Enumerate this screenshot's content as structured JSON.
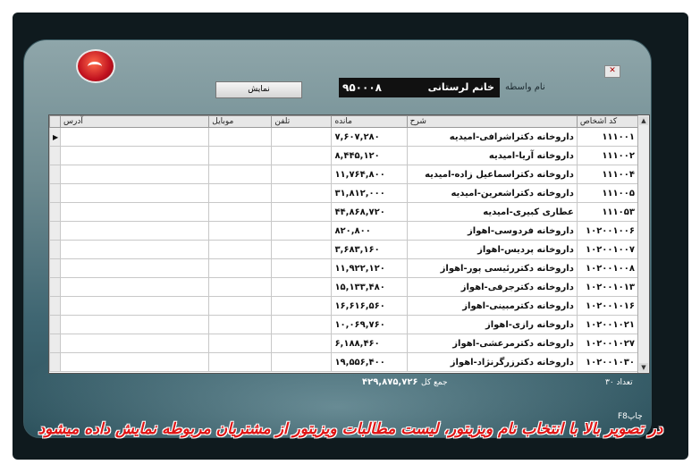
{
  "header": {
    "name_label": "نام واسطه",
    "name_value": "خانم لرستانی",
    "code_value": "۹۵۰۰۰۸",
    "show_button": "نمایش",
    "close_glyph": "✕"
  },
  "grid": {
    "columns": [
      "آدرس",
      "موبایل",
      "تلفن",
      "مانده",
      "شرح",
      "کد اشخاص"
    ],
    "rows": [
      {
        "code": "۱۱۱۰۰۱",
        "desc": "داروخانه دکتراشرافی-امیدیه",
        "balance": "۷,۶۰۷,۲۸۰"
      },
      {
        "code": "۱۱۱۰۰۲",
        "desc": "داروخانه آریا-امیدیه",
        "balance": "۸,۴۴۵,۱۲۰"
      },
      {
        "code": "۱۱۱۰۰۴",
        "desc": "داروخانه دکتراسماعیل زاده-امیدیه",
        "balance": "۱۱,۷۶۴,۸۰۰"
      },
      {
        "code": "۱۱۱۰۰۵",
        "desc": "داروخانه دکتراشعرین-امیدیه",
        "balance": "۳۱,۸۱۲,۰۰۰"
      },
      {
        "code": "۱۱۱۰۵۳",
        "desc": "عطاری کبیری-امیدیه",
        "balance": "۴۴,۸۶۸,۷۲۰"
      },
      {
        "code": "۱۰۲۰۰۱۰۰۶",
        "desc": "داروخانه فردوسی-اهواز",
        "balance": "۸۲۰,۸۰۰"
      },
      {
        "code": "۱۰۲۰۰۱۰۰۷",
        "desc": "داروخانه پردیس-اهواز",
        "balance": "۳,۶۸۳,۱۶۰"
      },
      {
        "code": "۱۰۲۰۰۱۰۰۸",
        "desc": "داروخانه دکتررئیسی پور-اهواز",
        "balance": "۱۱,۹۲۲,۱۲۰"
      },
      {
        "code": "۱۰۲۰۰۱۰۱۳",
        "desc": "داروخانه دکترجرفی-اهواز",
        "balance": "۱۵,۱۳۳,۴۸۰"
      },
      {
        "code": "۱۰۲۰۰۱۰۱۶",
        "desc": "داروخانه دکترمبینی-اهواز",
        "balance": "۱۶,۶۱۶,۵۶۰"
      },
      {
        "code": "۱۰۲۰۰۱۰۲۱",
        "desc": "داروخانه رازی-اهواز",
        "balance": "۱۰,۰۶۹,۷۶۰"
      },
      {
        "code": "۱۰۲۰۰۱۰۲۷",
        "desc": "داروخانه دکترمرعشی-اهواز",
        "balance": "۶,۱۸۸,۴۶۰"
      },
      {
        "code": "۱۰۲۰۰۱۰۳۰",
        "desc": "داروخانه دکترزرگرنژاد-اهواز",
        "balance": "۱۹,۵۵۶,۴۰۰"
      }
    ],
    "selected_marker": "▶"
  },
  "footer": {
    "total_label": "جمع کل",
    "total_value": "۴۲۹,۸۷۵,۷۲۶",
    "count_label": "تعداد ۳۰",
    "print_label": "F8چاپ"
  },
  "caption": "در تصویر بالا با انتخاب نام ویزیتور، لیست مطالبات ویزیتور از مشتریان مربوطه نمایش داده میشود",
  "colors": {
    "caption": "#e01414",
    "window_top": "#8fa6aa",
    "window_bottom": "#2a4f5a"
  }
}
